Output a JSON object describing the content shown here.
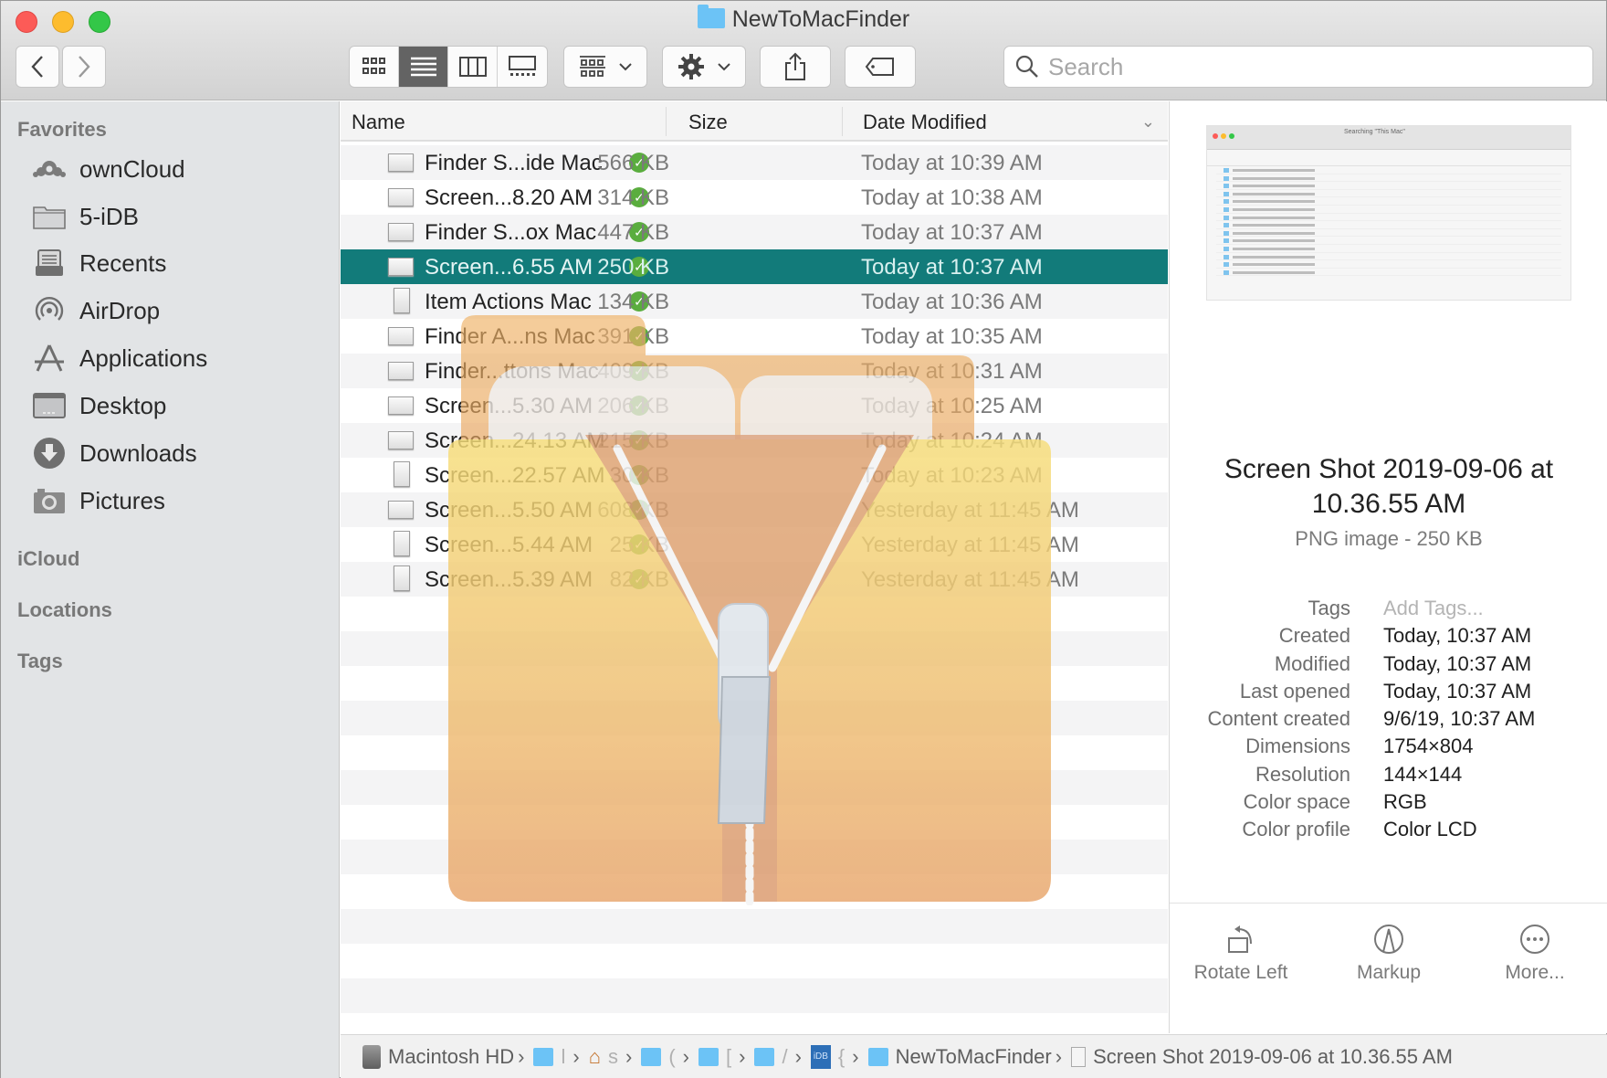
{
  "window": {
    "title": "NewToMacFinder"
  },
  "toolbar": {
    "back_icon": "chevron-left-icon",
    "forward_icon": "chevron-right-icon",
    "view_modes": [
      "icon-view",
      "list-view",
      "column-view",
      "gallery-view"
    ],
    "active_view": "list-view",
    "group_icon": "group-by-icon",
    "action_icon": "gear-icon",
    "share_icon": "share-icon",
    "tag_icon": "tag-icon",
    "search_placeholder": "Search"
  },
  "sidebar": {
    "favorites_label": "Favorites",
    "items": [
      {
        "label": "ownCloud",
        "icon": "cloud-icon"
      },
      {
        "label": "5-iDB",
        "icon": "folder-icon"
      },
      {
        "label": "Recents",
        "icon": "recents-icon"
      },
      {
        "label": "AirDrop",
        "icon": "airdrop-icon"
      },
      {
        "label": "Applications",
        "icon": "applications-icon"
      },
      {
        "label": "Desktop",
        "icon": "desktop-icon"
      },
      {
        "label": "Downloads",
        "icon": "downloads-icon"
      },
      {
        "label": "Pictures",
        "icon": "camera-icon"
      }
    ],
    "icloud_label": "iCloud",
    "locations_label": "Locations",
    "tags_label": "Tags"
  },
  "list": {
    "columns": {
      "name": "Name",
      "size": "Size",
      "date": "Date Modified"
    },
    "files": [
      {
        "name": "Finder S...ide Mac",
        "size": "566 KB",
        "date": "Today at 10:39 AM",
        "selected": false
      },
      {
        "name": "Screen...8.20 AM",
        "size": "314 KB",
        "date": "Today at 10:38 AM",
        "selected": false
      },
      {
        "name": "Finder S...ox Mac",
        "size": "447 KB",
        "date": "Today at 10:37 AM",
        "selected": false
      },
      {
        "name": "Screen...6.55 AM",
        "size": "250 KB",
        "date": "Today at 10:37 AM",
        "selected": true
      },
      {
        "name": "Item Actions Mac",
        "size": "134 KB",
        "date": "Today at 10:36 AM",
        "selected": false
      },
      {
        "name": "Finder A...ns Mac",
        "size": "391 KB",
        "date": "Today at 10:35 AM",
        "selected": false
      },
      {
        "name": "Finder...ttons Mac",
        "size": "409 KB",
        "date": "Today at 10:31 AM",
        "selected": false
      },
      {
        "name": "Screen...5.30 AM",
        "size": "206 KB",
        "date": "Today at 10:25 AM",
        "selected": false
      },
      {
        "name": "Screen...24.13 AM",
        "size": "215 KB",
        "date": "Today at 10:24 AM",
        "selected": false
      },
      {
        "name": "Screen...22.57 AM",
        "size": "30 KB",
        "date": "Today at 10:23 AM",
        "selected": false
      },
      {
        "name": "Screen...5.50 AM",
        "size": "608 KB",
        "date": "Yesterday at 11:45 AM",
        "selected": false
      },
      {
        "name": "Screen...5.44 AM",
        "size": "25 KB",
        "date": "Yesterday at 11:45 AM",
        "selected": false
      },
      {
        "name": "Screen...5.39 AM",
        "size": "82 KB",
        "date": "Yesterday at 11:45 AM",
        "selected": false
      }
    ],
    "overlay_icon": "zip-archive-icon"
  },
  "preview": {
    "title": "Screen Shot 2019-09-06 at 10.36.55 AM",
    "subtitle": "PNG image - 250 KB",
    "thumbnail_title": "Searching \"This Mac\"",
    "metadata": [
      {
        "key": "Tags",
        "value": "Add Tags...",
        "placeholder": true
      },
      {
        "key": "Created",
        "value": "Today, 10:37 AM"
      },
      {
        "key": "Modified",
        "value": "Today, 10:37 AM"
      },
      {
        "key": "Last opened",
        "value": "Today, 10:37 AM"
      },
      {
        "key": "Content created",
        "value": "9/6/19, 10:37 AM"
      },
      {
        "key": "Dimensions",
        "value": "1754×804"
      },
      {
        "key": "Resolution",
        "value": "144×144"
      },
      {
        "key": "Color space",
        "value": "RGB"
      },
      {
        "key": "Color profile",
        "value": "Color LCD"
      }
    ],
    "actions": [
      {
        "label": "Rotate Left",
        "icon": "rotate-left-icon"
      },
      {
        "label": "Markup",
        "icon": "markup-icon"
      },
      {
        "label": "More...",
        "icon": "more-icon"
      }
    ]
  },
  "pathbar": {
    "crumbs": [
      {
        "label": "Macintosh HD",
        "icon": "hard-drive-icon"
      },
      {
        "label": "",
        "icon": "user-folder-icon",
        "trunc": "l"
      },
      {
        "label": "",
        "icon": "home-icon",
        "trunc": "s"
      },
      {
        "label": "",
        "icon": "folder-icon",
        "trunc": "("
      },
      {
        "label": "",
        "icon": "folder-icon",
        "trunc": "["
      },
      {
        "label": "",
        "icon": "folder-icon",
        "trunc": "/"
      },
      {
        "label": "",
        "icon": "idb-folder-icon",
        "trunc": "{"
      },
      {
        "label": "NewToMacFinder",
        "icon": "folder-icon"
      },
      {
        "label": "Screen Shot 2019-09-06 at 10.36.55 AM",
        "icon": "document-icon"
      }
    ]
  },
  "colors": {
    "selection": "#127b7a",
    "check_green": "#5aad3e",
    "folder_blue": "#6cc3f6"
  }
}
